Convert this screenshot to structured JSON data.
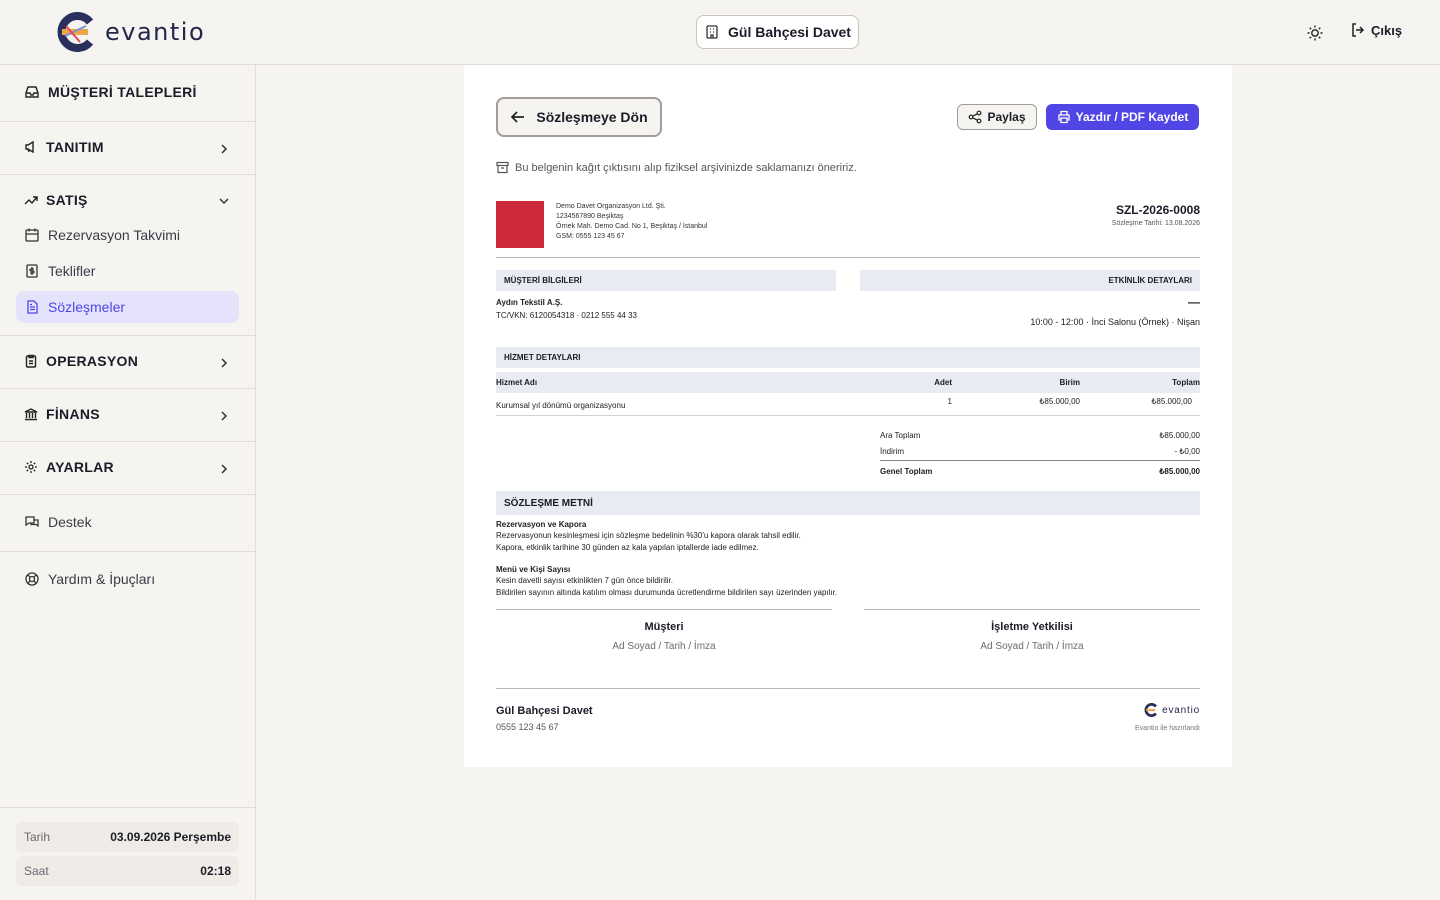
{
  "header": {
    "logo_text": "evantio",
    "business_name": "Gül Bahçesi Davet",
    "logout_label": "Çıkış"
  },
  "sidebar": {
    "requests": "MÜŞTERİ TALEPLERİ",
    "promotion": "TANITIM",
    "sales": "SATIŞ",
    "sales_items": [
      "Rezervasyon Takvimi",
      "Teklifler",
      "Sözleşmeler"
    ],
    "operations": "OPERASYON",
    "finance": "FİNANS",
    "settings": "AYARLAR",
    "support": "Destek",
    "help": "Yardım & İpuçları",
    "footer": {
      "date_label": "Tarih",
      "date_value": "03.09.2026 Perşembe",
      "time_label": "Saat",
      "time_value": "02:18"
    }
  },
  "doc": {
    "back_label": "Sözleşmeye Dön",
    "share_label": "Paylaş",
    "print_label": "Yazdır / PDF Kaydet",
    "note": "Bu belgenin kağıt çıktısını alıp fiziksel arşivinizde saklamanızı öneririz.",
    "company_lines": [
      "Demo Davet Organizasyon Ltd. Şti.",
      "1234567890 Beşiktaş",
      "Örnek Mah. Demo Cad. No 1, Beşiktaş / İstanbul",
      "GSM: 0555 123 45 67"
    ],
    "number": "SZL-2026-0008",
    "date_line": "Sözleşme Tarihi: 13.08.2026",
    "customer_title": "MÜŞTERİ BİLGİLERİ",
    "customer_name": "Aydın Tekstil A.Ş.",
    "customer_tax": "TC/VKN: 6120054318 · 0212 555 44 33",
    "event_title": "ETKİNLİK DETAYLARI",
    "event_dash": "—",
    "event_line": "10:00 - 12:00 · İnci Salonu (Örnek) · Nişan",
    "service_title": "HİZMET DETAYLARI",
    "columns": [
      "Hizmet Adı",
      "Adet",
      "Birim",
      "Toplam"
    ],
    "rows": [
      {
        "name": "Kurumsal yıl dönümü organizasyonu",
        "qty": "1",
        "unit": "₺85.000,00",
        "total": "₺85.000,00"
      }
    ],
    "subtotal_label": "Ara Toplam",
    "subtotal_value": "₺85.000,00",
    "discount_label": "İndirim",
    "discount_value": "- ₺0,00",
    "grand_label": "Genel Toplam",
    "grand_value": "₺85.000,00",
    "contract_title": "SÖZLEŞME METNİ",
    "clauses": [
      {
        "title": "Rezervasyon ve Kapora",
        "lines": [
          "Rezervasyonun kesinleşmesi için sözleşme bedelinin %30'u kapora olarak tahsil edilir.",
          "Kapora, etkinlik tarihine 30 günden az kala yapılan iptallerde iade edilmez."
        ]
      },
      {
        "title": "Menü ve Kişi Sayısı",
        "lines": [
          "Kesin davetli sayısı etkinlikten 7 gün önce bildirilir.",
          "Bildirilen sayının altında katılım olması durumunda ücretlendirme bildirilen sayı üzerinden yapılır."
        ]
      }
    ],
    "sig_customer": "Müşteri",
    "sig_owner": "İşletme Yetkilisi",
    "sig_sub": "Ad Soyad / Tarih / İmza",
    "footer_name": "Gül Bahçesi Davet",
    "footer_phone": "0555 123 45 67",
    "footer_brand": "evantio",
    "footer_made": "Evantio ile hazırlandı"
  }
}
